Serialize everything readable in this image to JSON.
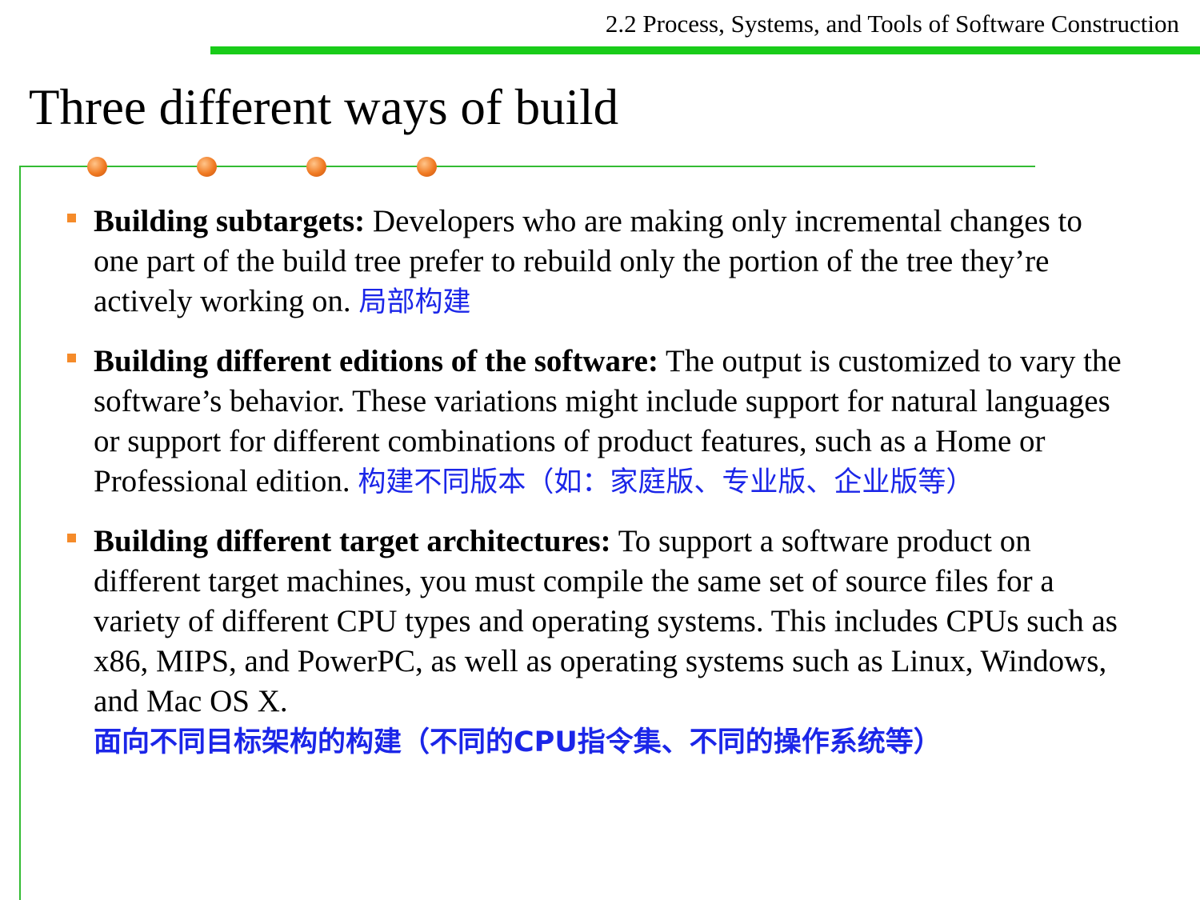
{
  "header": {
    "section_title": "2.2 Process, Systems, and Tools of Software Construction"
  },
  "slide": {
    "title": "Three different ways of build"
  },
  "bullets": [
    {
      "term": "Building subtargets:",
      "text": "Developers who are making only incremental changes to one part of the build tree prefer to rebuild only the portion of the tree they’re actively working on.",
      "note_cn": "局部构建"
    },
    {
      "term": "Building different editions of the software:",
      "text": "The output is customized to vary the software’s behavior. These variations might include support for natural languages or support for different combinations of product features, such as a Home or Professional edition.",
      "note_cn": "构建不同版本（如：家庭版、专业版、企业版等）"
    },
    {
      "term": "Building different target architectures:",
      "text": "To support a software product on different target machines, you must compile the same set of source files for a variety of different CPU types and operating systems. This includes CPUs such as x86, MIPS, and PowerPC, as well as operating systems such as Linux, Windows, and Mac OS X.",
      "note_cn": "面向不同目标架构的构建（不同的CPU指令集、不同的操作系统等）"
    }
  ],
  "colors": {
    "accent_green": "#19cc19",
    "bullet_orange": "#f58b2a",
    "note_blue": "#1b26e8"
  }
}
